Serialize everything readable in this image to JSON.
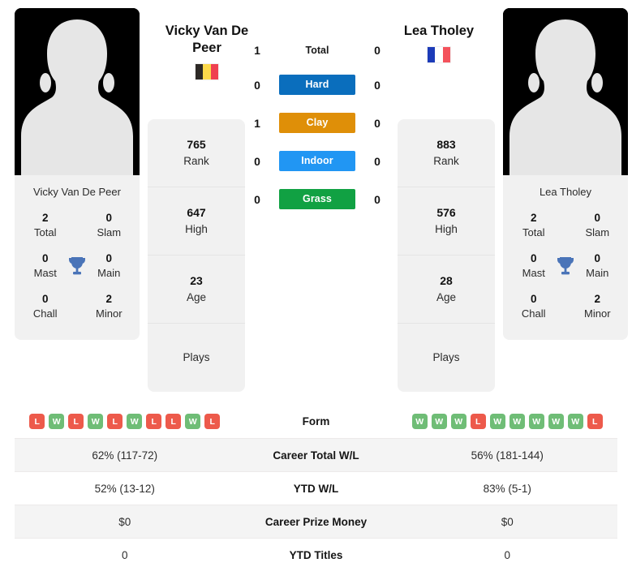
{
  "players": {
    "left": {
      "name": "Vicky Van De Peer",
      "display_name_line1": "Vicky Van De",
      "display_name_line2": "Peer",
      "country": "Belgium",
      "flag_colors": [
        "#2d2926",
        "#fcd94b",
        "#ef4050"
      ],
      "avatar_label": "player-photo-placeholder",
      "titles": {
        "total_num": "2",
        "total_label": "Total",
        "slam_num": "0",
        "slam_label": "Slam",
        "mast_num": "0",
        "mast_label": "Mast",
        "main_num": "0",
        "main_label": "Main",
        "chall_num": "0",
        "chall_label": "Chall",
        "minor_num": "2",
        "minor_label": "Minor"
      },
      "strip": [
        {
          "value": "765",
          "label": "Rank"
        },
        {
          "value": "647",
          "label": "High"
        },
        {
          "value": "23",
          "label": "Age"
        },
        {
          "value": "",
          "label": "Plays"
        }
      ],
      "form": [
        "L",
        "W",
        "L",
        "W",
        "L",
        "W",
        "L",
        "L",
        "W",
        "L"
      ],
      "career_total_wl": "62% (117-72)",
      "ytd_wl": "52% (13-12)",
      "career_prize_money": "$0",
      "ytd_titles": "0"
    },
    "right": {
      "name": "Lea Tholey",
      "display_name_line1": "Lea Tholey",
      "display_name_line2": "",
      "country": "France",
      "flag_colors": [
        "#1c3bb8",
        "#ffffff",
        "#f4525c"
      ],
      "avatar_label": "player-photo-placeholder",
      "titles": {
        "total_num": "2",
        "total_label": "Total",
        "slam_num": "0",
        "slam_label": "Slam",
        "mast_num": "0",
        "mast_label": "Mast",
        "main_num": "0",
        "main_label": "Main",
        "chall_num": "0",
        "chall_label": "Chall",
        "minor_num": "2",
        "minor_label": "Minor"
      },
      "strip": [
        {
          "value": "883",
          "label": "Rank"
        },
        {
          "value": "576",
          "label": "High"
        },
        {
          "value": "28",
          "label": "Age"
        },
        {
          "value": "",
          "label": "Plays"
        }
      ],
      "form": [
        "W",
        "W",
        "W",
        "L",
        "W",
        "W",
        "W",
        "W",
        "W",
        "L"
      ],
      "career_total_wl": "56% (181-144)",
      "ytd_wl": "83% (5-1)",
      "career_prize_money": "$0",
      "ytd_titles": "0"
    }
  },
  "head_to_head": [
    {
      "label": "Total",
      "left": "1",
      "right": "0",
      "style": "plain",
      "color": ""
    },
    {
      "label": "Hard",
      "left": "0",
      "right": "0",
      "style": "pill",
      "color": "#0a6ebd"
    },
    {
      "label": "Clay",
      "left": "1",
      "right": "0",
      "style": "pill",
      "color": "#df8f08"
    },
    {
      "label": "Indoor",
      "left": "0",
      "right": "0",
      "style": "pill",
      "color": "#2196f3"
    },
    {
      "label": "Grass",
      "left": "0",
      "right": "0",
      "style": "pill",
      "color": "#11a143"
    }
  ],
  "stats_table": {
    "form_label": "Form",
    "rows": [
      {
        "label": "Career Total W/L",
        "left": "62% (117-72)",
        "right": "56% (181-144)"
      },
      {
        "label": "YTD W/L",
        "left": "52% (13-12)",
        "right": "83% (5-1)"
      },
      {
        "label": "Career Prize Money",
        "left": "$0",
        "right": "$0"
      },
      {
        "label": "YTD Titles",
        "left": "0",
        "right": "0"
      }
    ]
  },
  "theme": {
    "card_bg": "#f1f1f1",
    "win_color": "#6fbd76",
    "loss_color": "#ed5a4b",
    "trophy_color": "#4a74b8"
  }
}
